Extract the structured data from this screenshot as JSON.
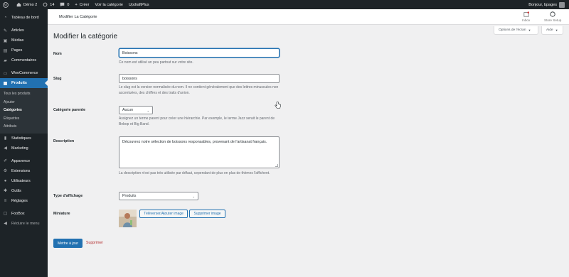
{
  "adminbar": {
    "site_name": "Démo 2",
    "updates_count": "14",
    "comments_count": "0",
    "new_label": "Créer",
    "view_label": "Voir la catégorie",
    "plugin_label": "UpdraftPlus",
    "greeting": "Bonjour, bpages"
  },
  "sidebar": {
    "dashboard": "Tableau de bord",
    "posts": "Articles",
    "media": "Médias",
    "pages": "Pages",
    "comments": "Commentaires",
    "woocommerce": "WooCommerce",
    "products": "Produits",
    "submenu": [
      "Tous les produits",
      "Ajouter",
      "Catégories",
      "Étiquettes",
      "Attributs"
    ],
    "stats": "Statistiques",
    "marketing": "Marketing",
    "appearance": "Apparence",
    "extensions": "Extensions",
    "users": "Utilisateurs",
    "tools": "Outils",
    "settings": "Réglages",
    "foobox": "FooBox",
    "collapse": "Réduire le menu"
  },
  "header": {
    "title": "Modifier La Catégorie",
    "inbox": "Inbox",
    "store_setup": "Store Setup",
    "screen_options": "Options de l'écran",
    "help": "Aide"
  },
  "page": {
    "title": "Modifier la catégorie"
  },
  "form": {
    "name_label": "Nom",
    "name_value": "Boissons",
    "name_desc": "Ce nom est utilisé un peu partout sur votre site.",
    "slug_label": "Slug",
    "slug_value": "boissons",
    "slug_desc": "Le slug est la version normalisée du nom. Il ne contient généralement que des lettres minuscules non accentuées, des chiffres et des traits d'union.",
    "parent_label": "Catégorie parente",
    "parent_value": "Aucun",
    "parent_desc": "Assignez un terme parent pour créer une hiérarchie. Par exemple, le terme Jazz serait le parent de Bebop et Big Band.",
    "description_label": "Description",
    "description_value": "Découvrez notre sélection de boissons responsables, provenant de l'artisanat français.",
    "description_desc": "La description n'est pas très utilisée par défaut, cependant de plus en plus de thèmes l'affichent.",
    "display_label": "Type d'affichage",
    "display_value": "Produits",
    "thumb_label": "Miniature",
    "upload_button": "Téléverser/Ajouter image",
    "remove_button": "Supprimer image",
    "update_button": "Mettre à jour",
    "delete_link": "Supprimer"
  },
  "colors": {
    "accent": "#2271b1",
    "sidebar_bg": "#1d2327",
    "danger": "#b32d2e"
  }
}
